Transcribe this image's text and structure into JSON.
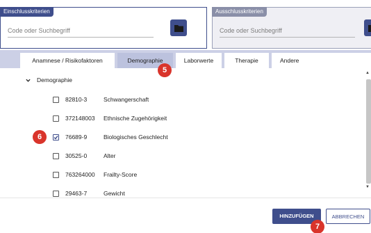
{
  "inclusion": {
    "title": "Einschlusskriterien",
    "placeholder": "Code oder Suchbegriff",
    "folder_icon": "folder-icon"
  },
  "exclusion": {
    "title": "Ausschlusskriterien",
    "placeholder": "Code oder Suchbegriff",
    "folder_icon": "folder-icon"
  },
  "tabs": [
    {
      "label": "Anamnese / Risikofaktoren",
      "active": false
    },
    {
      "label": "Demographie",
      "active": true
    },
    {
      "label": "Laborwerte",
      "active": false
    },
    {
      "label": "Therapie",
      "active": false
    },
    {
      "label": "Andere",
      "active": false
    }
  ],
  "annotations": {
    "tabs_step": "5",
    "checkbox_step": "6",
    "add_step": "7"
  },
  "section": {
    "title": "Demographie",
    "expanded": true,
    "items": [
      {
        "code": "82810-3",
        "label": "Schwangerschaft",
        "checked": false
      },
      {
        "code": "372148003",
        "label": "Ethnische Zugehörigkeit",
        "checked": false
      },
      {
        "code": "76689-9",
        "label": "Biologisches Geschlecht",
        "checked": true
      },
      {
        "code": "30525-0",
        "label": "Alter",
        "checked": false
      },
      {
        "code": "763264000",
        "label": "Frailty-Score",
        "checked": false
      },
      {
        "code": "29463-7",
        "label": "Gewicht",
        "checked": false
      }
    ]
  },
  "buttons": {
    "add": "HINZUFÜGEN",
    "cancel": "ABBRECHEN"
  },
  "colors": {
    "primary": "#3f4e8c",
    "tabbar": "#ccd0e6",
    "badge": "#d9342b"
  }
}
